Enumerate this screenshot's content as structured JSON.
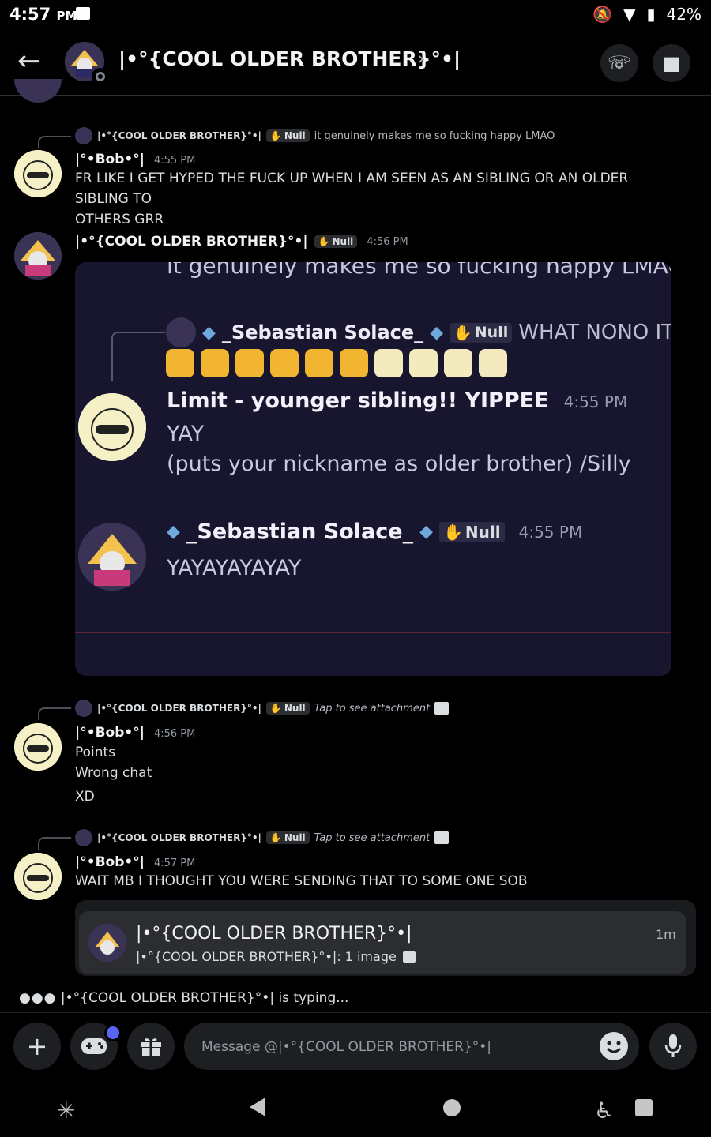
{
  "status_bar": {
    "time": "4:57",
    "ampm": "PM",
    "battery": "42%"
  },
  "header": {
    "title": "|•°{COOL OLDER BROTHER}°•|",
    "back_icon": "arrow-left-icon",
    "call_icon": "phone-icon",
    "video_icon": "video-camera-icon"
  },
  "messages": [
    {
      "reply": {
        "name": "|•°{COOL OLDER BROTHER}°•|",
        "tag": "Null",
        "text": "it genuinely makes me so fucking happy LMAO"
      },
      "author": "|°•Bob•°|",
      "time": "4:55 PM",
      "lines": [
        "FR LIKE I GET HYPED THE FUCK UP WHEN I AM SEEN AS AN SIBLING OR AN OLDER SIBLING TO",
        "OTHERS GRR"
      ]
    },
    {
      "author": "|•°{COOL OLDER BROTHER}°•|",
      "tag": "Null",
      "time": "4:56 PM",
      "attachment": {
        "top_text": "it genuinely makes me so fucking happy LMAO",
        "reply_name": "_Sebastian Solace_",
        "reply_tag": "Null",
        "reply_text": "WHAT NONO ITS",
        "msg1_author": "Limit - younger sibling!! YIPPEE",
        "msg1_time": "4:55 PM",
        "msg1_line1": "YAY",
        "msg1_line2": "(puts your nickname as older brother) /Silly",
        "msg2_author": "_Sebastian Solace_",
        "msg2_tag": "Null",
        "msg2_time": "4:55 PM",
        "msg2_line1": "YAYAYAYAYAY"
      }
    },
    {
      "reply": {
        "name": "|•°{COOL OLDER BROTHER}°•|",
        "tag": "Null",
        "text": "Tap to see attachment"
      },
      "author": "|°•Bob•°|",
      "time": "4:56 PM",
      "lines": [
        "Points",
        "Wrong chat",
        "XD"
      ]
    },
    {
      "reply": {
        "name": "|•°{COOL OLDER BROTHER}°•|",
        "tag": "Null",
        "text": "Tap to see attachment"
      },
      "author": "|°•Bob•°|",
      "time": "4:57 PM",
      "lines": [
        "WAIT MB I THOUGHT YOU WERE SENDING THAT TO SOME ONE SOB"
      ]
    }
  ],
  "forward": {
    "name": "|•°{COOL OLDER BROTHER}°•|",
    "preview": "|•°{COOL OLDER BROTHER}°•|: 1 image",
    "time": "1m"
  },
  "typing": {
    "text": "|•°{COOL OLDER BROTHER}°•| is typing..."
  },
  "composer": {
    "placeholder": "Message @|•°{COOL OLDER BROTHER}°•|"
  },
  "colors": {
    "background": "#000000",
    "embed_bg": "#17162e",
    "unread_dot": "#5865f2"
  }
}
